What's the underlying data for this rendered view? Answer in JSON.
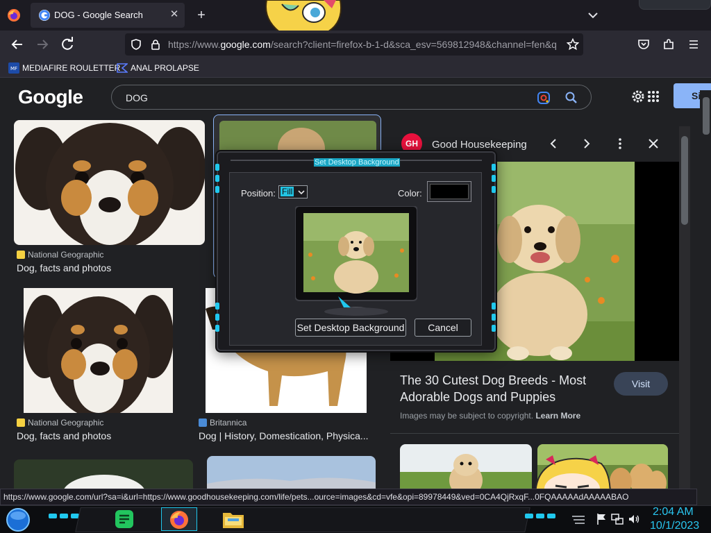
{
  "browser": {
    "tab": {
      "title": "DOG - Google Search"
    },
    "url": {
      "prefix": "https://www.",
      "domain": "google.com",
      "rest": "/search?client=firefox-b-1-d&sca_esv=569812948&channel=fen&q"
    },
    "bookmarks": [
      {
        "label": "MEDIAFIRE ROULETTER",
        "icon": "mediafire-icon"
      },
      {
        "label": "ANAL PROLAPSE",
        "icon": "bookmark-triangle-icon"
      }
    ],
    "status_url": "https://www.google.com/url?sa=i&url=https://www.goodhousekeeping.com/life/pets...ource=images&cd=vfe&opi=89978449&ved=0CA4QjRxqF...0FQAAAAAdAAAAABAO"
  },
  "google": {
    "logo": "Google",
    "query": "DOG",
    "signin_partial": "Si"
  },
  "results": [
    {
      "source": "National Geographic",
      "title": "Dog, facts and photos",
      "color": "#f5d142"
    },
    {
      "source": "National Geographic",
      "title": "Dog, facts and photos",
      "color": "#f5d142"
    },
    {
      "source": "Britannica",
      "title": "Dog | History, Domestication, Physica...",
      "color": "#4a8bd6"
    }
  ],
  "panel": {
    "badge": "GH",
    "source": "Good Housekeeping",
    "title": "The 30 Cutest Dog Breeds - Most Adorable Dogs and Puppies",
    "visit": "Visit",
    "copyright_prefix": "Images may be subject to copyright. ",
    "learn_more": "Learn More"
  },
  "dialog": {
    "title": "Set Desktop Background",
    "position_label": "Position:",
    "position_value": "Fill",
    "color_label": "Color:",
    "color_value": "#000000",
    "set_button": "Set Desktop Background",
    "cancel_button": "Cancel"
  },
  "taskbar": {
    "time": "2:04 AM",
    "date": "10/1/2023"
  }
}
